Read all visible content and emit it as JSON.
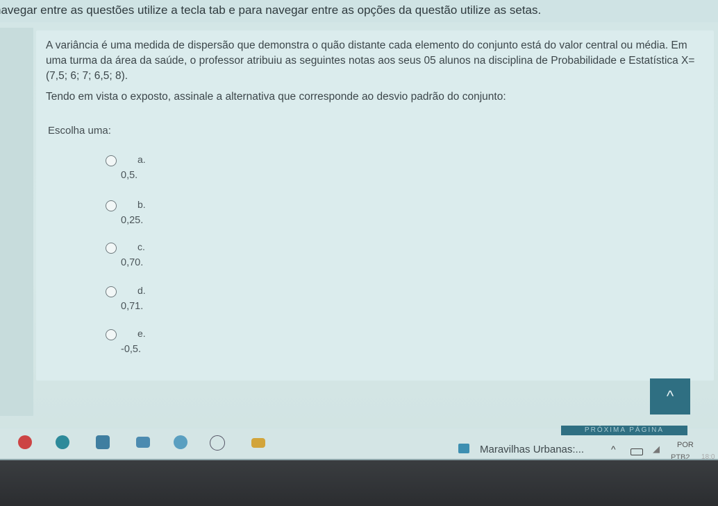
{
  "instruction": "navegar entre as questões utilize a tecla tab e para navegar entre as opções da questão utilize as setas.",
  "question": {
    "paragraph1": "A variância é uma medida de dispersão que demonstra o quão distante cada elemento do conjunto está do valor central ou média. Em uma turma da área da saúde, o professor atribuiu as seguintes notas aos seus 05 alunos na disciplina de Probabilidade e Estatística X=(7,5; 6; 7; 6,5; 8).",
    "paragraph2": "Tendo em vista o exposto, assinale a alternativa que corresponde ao desvio padrão do conjunto:",
    "choose_label": "Escolha uma:",
    "options": [
      {
        "letter": "a.",
        "value": "0,5."
      },
      {
        "letter": "b.",
        "value": "0,25."
      },
      {
        "letter": "c.",
        "value": "0,70."
      },
      {
        "letter": "d.",
        "value": "0,71."
      },
      {
        "letter": "e.",
        "value": "-0,5."
      }
    ]
  },
  "scroll_top_icon": "chevron-up-icon",
  "scroll_top_glyph": "^",
  "next_page_label": "PRÓXIMA PÁGINA",
  "taskbar": {
    "media_label": "Maravilhas Urbanas:...",
    "lang_top": "POR",
    "lang_bottom": "PTB2",
    "clock": "18:0",
    "icons": [
      "chrome-icon",
      "edge-icon",
      "store-icon",
      "mail-icon",
      "photos-icon",
      "dell-icon",
      "folder-icon"
    ]
  },
  "colors": {
    "accent": "#2f6f82",
    "background": "#cfe3e4"
  }
}
